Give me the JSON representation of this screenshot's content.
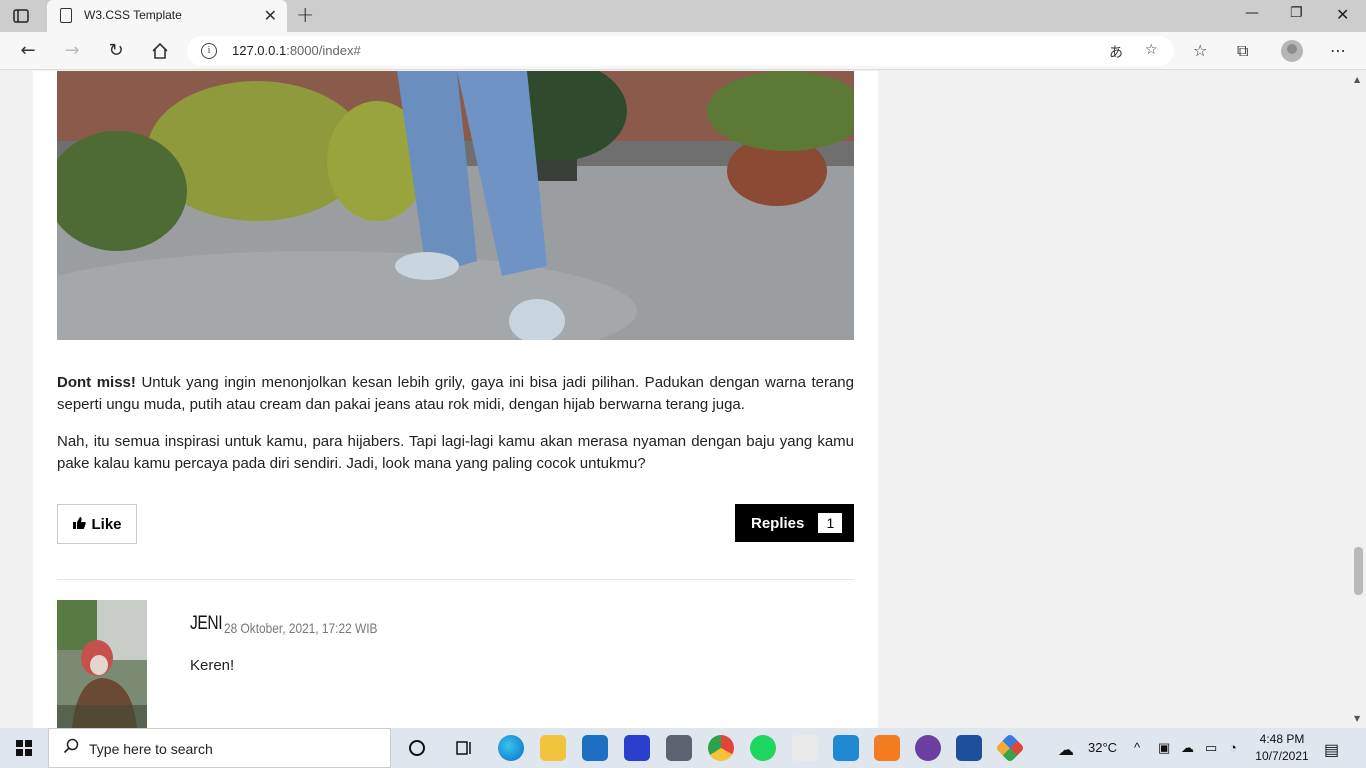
{
  "browser": {
    "tab_title": "W3.CSS Template",
    "url_host": "127.0.0.1",
    "url_rest": ":8000/index#"
  },
  "article": {
    "para1_bold": "Dont miss!",
    "para1_text": " Untuk yang ingin menonjolkan kesan lebih grily, gaya ini bisa jadi pilihan. Padukan dengan warna terang seperti ungu muda, putih atau cream dan pakai jeans atau rok midi, dengan hijab berwarna terang juga.",
    "para2_text": "Nah, itu semua inspirasi untuk kamu, para hijabers. Tapi lagi-lagi kamu akan merasa nyaman dengan baju yang kamu pake kalau kamu percaya pada diri sendiri. Jadi, look mana yang paling cocok untukmu?",
    "like_label": "Like",
    "replies_label": "Replies",
    "replies_count": "1"
  },
  "comment": {
    "name": "JENI",
    "date": "28 Oktober, 2021, 17:22 WIB",
    "text": "Keren!"
  },
  "taskbar": {
    "search_placeholder": "Type here to search",
    "temperature": "32°C",
    "time": "4:48 PM",
    "date": "10/7/2021"
  }
}
